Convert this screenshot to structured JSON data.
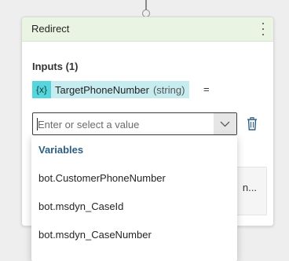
{
  "card": {
    "title": "Redirect",
    "inputs_label": "Inputs (1)",
    "variable": {
      "icon": "{x}",
      "name": "TargetPhoneNumber",
      "type": "(string)"
    },
    "equals": "=",
    "value_input": {
      "value": "",
      "placeholder": "Enter or select a value"
    },
    "behind_text": "n..."
  },
  "dropdown": {
    "header": "Variables",
    "items": [
      "bot.CustomerPhoneNumber",
      "bot.msdyn_CaseId",
      "bot.msdyn_CaseNumber"
    ]
  },
  "colors": {
    "header_bg": "#e9f5e2",
    "chip_icon_bg": "#55d6dc",
    "chip_bg": "#c7ecef",
    "dropdown_header": "#2b5e83"
  },
  "icons": {
    "more": "more-vertical-icon",
    "chevron": "chevron-down-icon",
    "trash": "trash-icon"
  }
}
